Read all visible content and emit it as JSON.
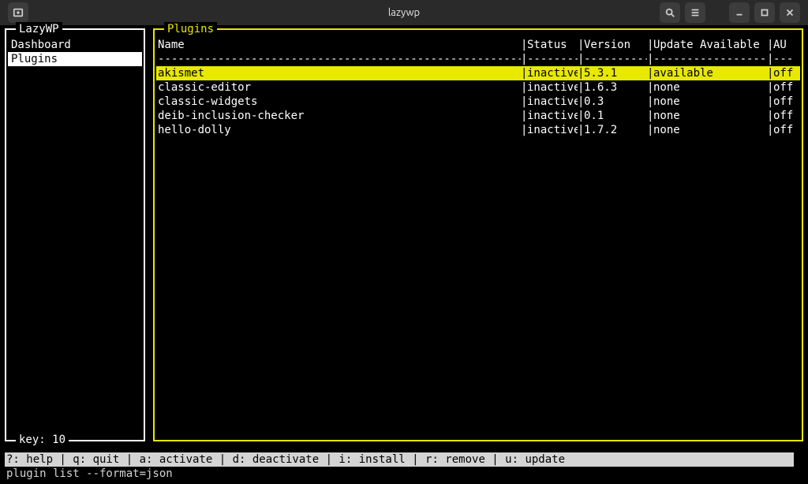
{
  "window": {
    "title": "lazywp"
  },
  "sidebar": {
    "title": " LazyWP ",
    "items": [
      {
        "label": "Dashboard",
        "selected": false
      },
      {
        "label": "Plugins",
        "selected": true
      }
    ],
    "footer": "key: 10"
  },
  "plugins_panel": {
    "title": " Plugins ",
    "headers": {
      "name": "Name",
      "status": "Status",
      "version": "Version",
      "update": "Update Available",
      "au": "AU"
    },
    "rows": [
      {
        "name": "akismet",
        "status": "inactive",
        "version": "5.3.1",
        "update": "available",
        "au": "off",
        "selected": true
      },
      {
        "name": "classic-editor",
        "status": "inactive",
        "version": "1.6.3",
        "update": "none",
        "au": "off",
        "selected": false
      },
      {
        "name": "classic-widgets",
        "status": "inactive",
        "version": "0.3",
        "update": "none",
        "au": "off",
        "selected": false
      },
      {
        "name": "deib-inclusion-checker",
        "status": "inactive",
        "version": "0.1",
        "update": "none",
        "au": "off",
        "selected": false
      },
      {
        "name": "hello-dolly",
        "status": "inactive",
        "version": "1.7.2",
        "update": "none",
        "au": "off",
        "selected": false
      }
    ]
  },
  "helpbar": "?: help | q: quit | a: activate | d: deactivate | i: install | r: remove | u: update",
  "command": "plugin list --format=json",
  "dashes": "--------------------------------------------------------------------------------------------------------------------------------------------------------"
}
